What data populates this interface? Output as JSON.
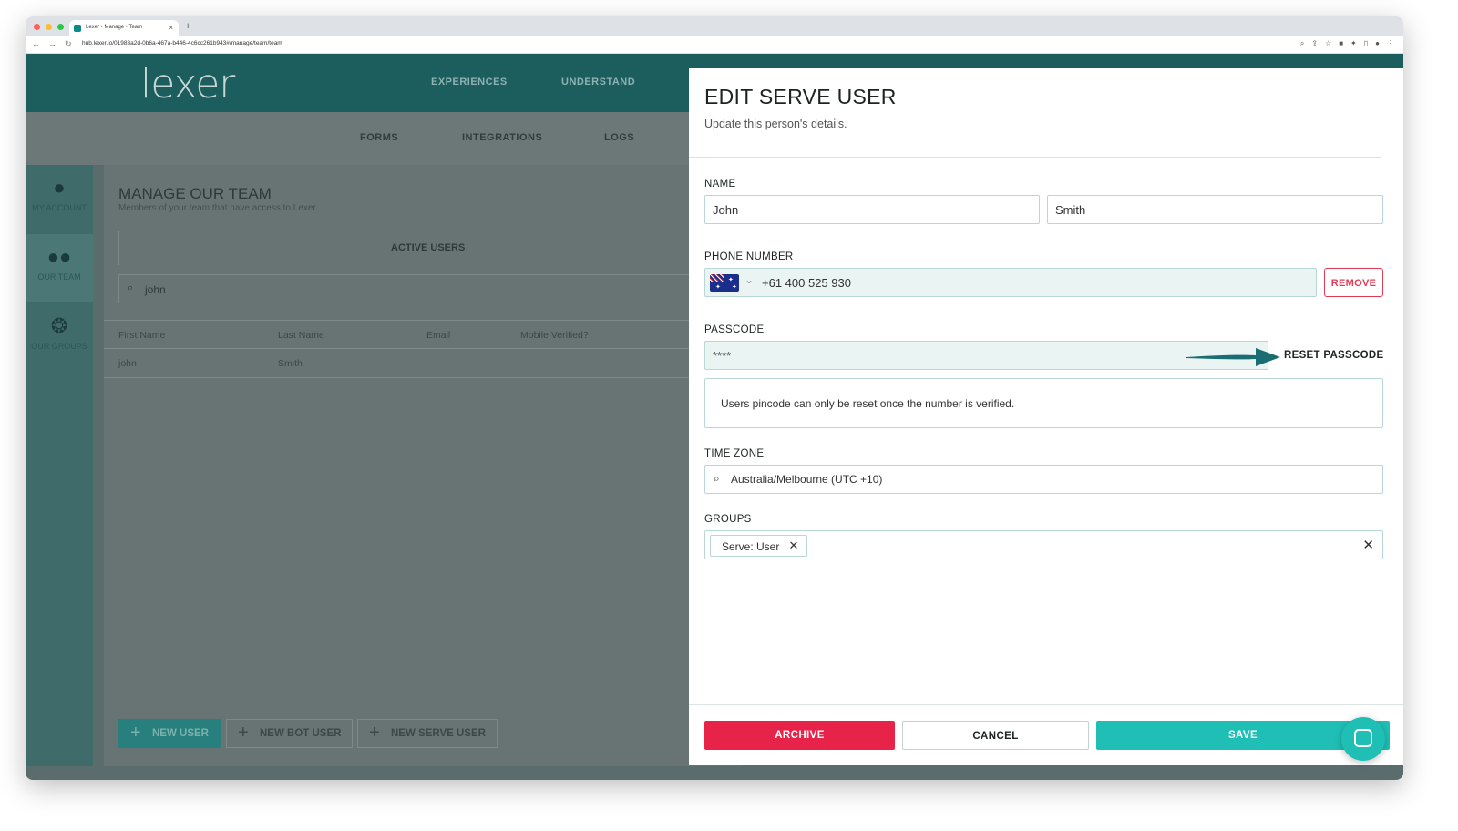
{
  "browser": {
    "tab_title": "Lexer • Manage • Team",
    "url": "hub.lexer.io/01983a2d-0b6a-467a-b446-4c6cc261b943#/manage/team/team"
  },
  "app": {
    "logo": "lexer",
    "main_nav": [
      "EXPERIENCES",
      "UNDERSTAND"
    ],
    "sub_nav": [
      "FORMS",
      "INTEGRATIONS",
      "LOGS"
    ],
    "sidebar": [
      {
        "label": "MY ACCOUNT",
        "icon": "user-icon"
      },
      {
        "label": "OUR TEAM",
        "icon": "team-icon"
      },
      {
        "label": "OUR GROUPS",
        "icon": "groups-icon"
      }
    ],
    "panel": {
      "title": "MANAGE OUR TEAM",
      "subtitle": "Members of your team that have access to Lexer.",
      "tab": "ACTIVE USERS",
      "search_value": "john",
      "columns": [
        "First Name",
        "Last Name",
        "Email",
        "Mobile Verified?"
      ],
      "rows": [
        {
          "first": "john",
          "last": "Smith"
        }
      ],
      "buttons": {
        "new_user": "NEW USER",
        "new_bot_user": "NEW BOT USER",
        "new_serve_user": "NEW SERVE USER"
      }
    }
  },
  "modal": {
    "title": "EDIT SERVE USER",
    "subtitle": "Update this person's details.",
    "name_label": "NAME",
    "first_name": "John",
    "last_name": "Smith",
    "phone_label": "PHONE NUMBER",
    "phone_value": "+61 400 525 930",
    "remove_label": "REMOVE",
    "passcode_label": "PASSCODE",
    "passcode_value": "****",
    "reset_label": "RESET PASSCODE",
    "info_text": "Users pincode can only be reset once the number is verified.",
    "timezone_label": "TIME ZONE",
    "timezone_value": "Australia/Melbourne (UTC +10)",
    "groups_label": "GROUPS",
    "group_chip": "Serve: User",
    "archive_label": "ARCHIVE",
    "cancel_label": "CANCEL",
    "save_label": "SAVE"
  },
  "colors": {
    "teal": "#1c5d5e",
    "accent": "#1fbfb6",
    "danger": "#e8234a",
    "arrow": "#1a6e72"
  }
}
